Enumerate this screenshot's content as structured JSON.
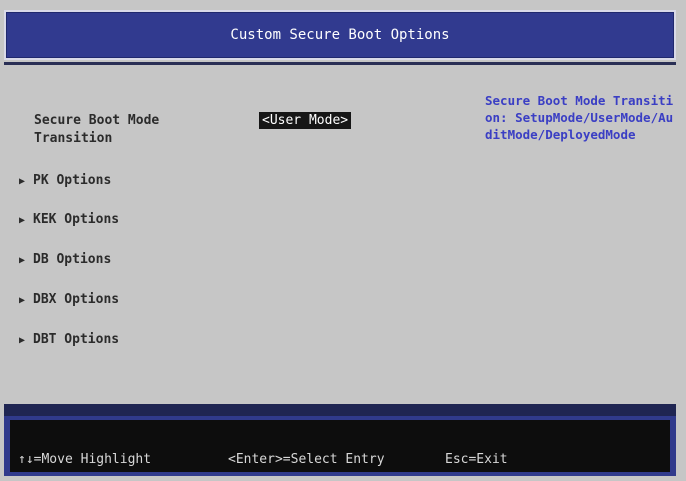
{
  "header": {
    "title": "Custom Secure Boot Options"
  },
  "setting": {
    "label": "Secure Boot Mode Transition",
    "value": "<User Mode>"
  },
  "menu": {
    "items": [
      {
        "label": "PK Options"
      },
      {
        "label": "KEK Options"
      },
      {
        "label": "DB Options"
      },
      {
        "label": "DBX Options"
      },
      {
        "label": "DBT Options"
      }
    ],
    "arrow_icon": "triangle-right-icon"
  },
  "help": {
    "text": "Secure Boot Mode Transition: SetupMode/UserMode/AuditMode/DeployedMode"
  },
  "footer": {
    "move": "↑↓=Move Highlight",
    "select": "<Enter>=Select Entry",
    "exit": "Esc=Exit"
  },
  "colors": {
    "title_bar": "#313a8f",
    "background": "#c6c6c6",
    "help_text": "#3a3ec4",
    "footer_bg": "#0d0d0d"
  }
}
